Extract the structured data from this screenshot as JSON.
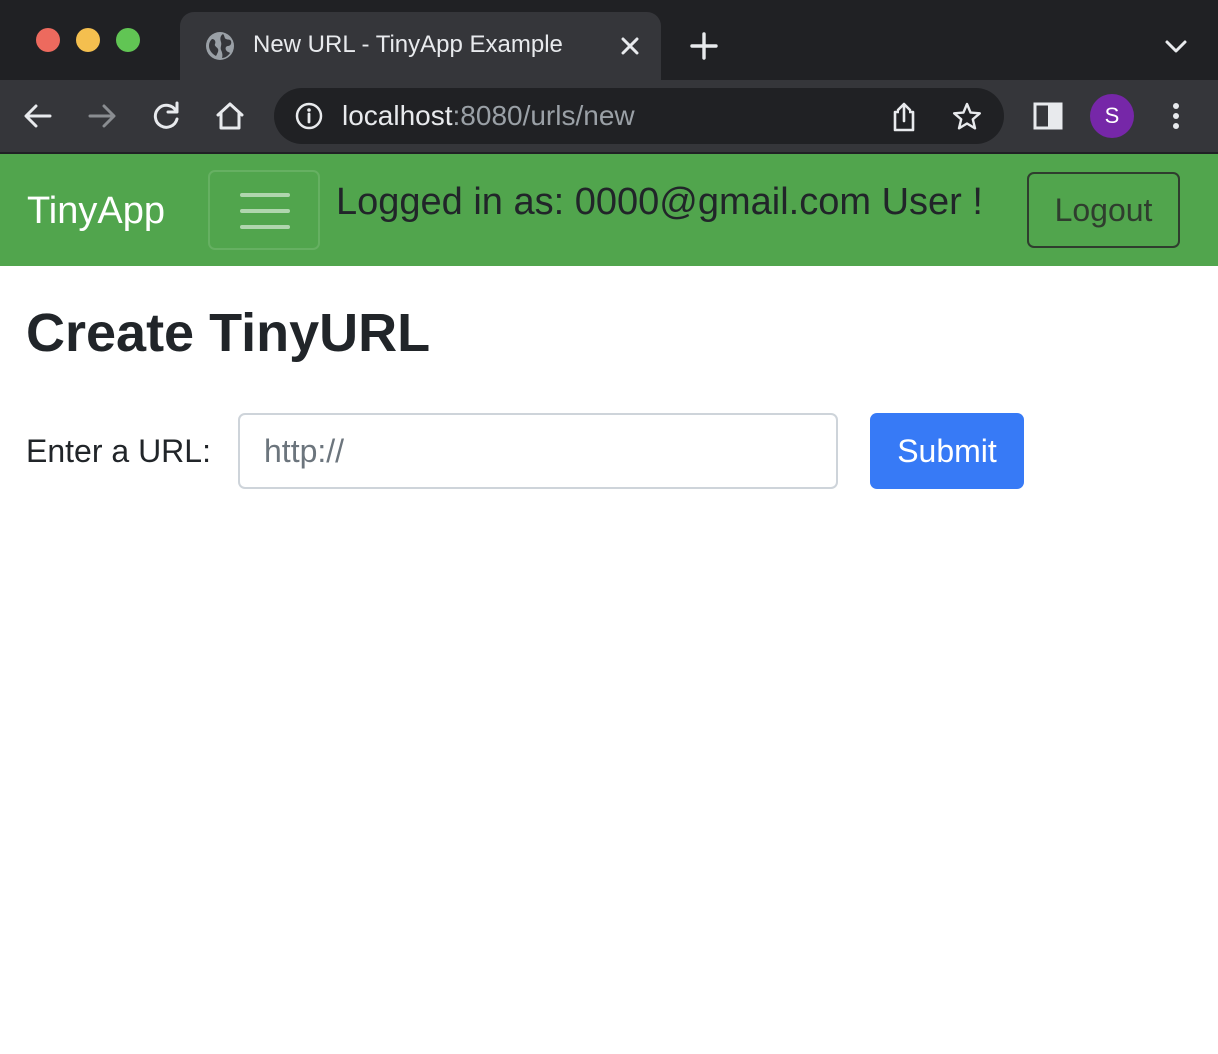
{
  "browser": {
    "tab": {
      "title": "New URL - TinyApp Example",
      "favicon": "globe-icon"
    },
    "address": {
      "host": "localhost",
      "path": ":8080/urls/new"
    },
    "profile_initial": "S",
    "icons": [
      "back-arrow-icon",
      "forward-arrow-icon",
      "reload-icon",
      "home-icon",
      "info-icon",
      "share-icon",
      "star-icon",
      "side-panel-icon",
      "more-vert-icon",
      "new-tab-plus-icon",
      "tab-search-chevron-icon",
      "close-icon"
    ],
    "colors": {
      "tabstrip": "#202124",
      "toolbar": "#35363a",
      "avatar": "#7627a8"
    }
  },
  "navbar": {
    "brand": "TinyApp",
    "logged_in_text": "Logged in as: 0000@gmail.com User !",
    "logout_label": "Logout",
    "colors": {
      "background": "#51a54d"
    }
  },
  "main": {
    "title": "Create TinyURL",
    "form": {
      "label": "Enter a URL:",
      "input_placeholder": "http://",
      "input_value": "",
      "submit_label": "Submit"
    },
    "colors": {
      "submit": "#377af6"
    }
  }
}
